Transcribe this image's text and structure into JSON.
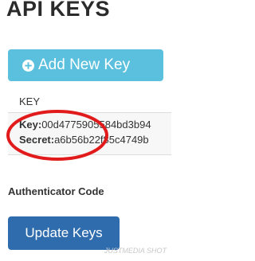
{
  "page": {
    "title": "API KEYS"
  },
  "actions": {
    "add_key_label": "Add New Key",
    "update_keys_label": "Update Keys"
  },
  "table": {
    "header": "KEY",
    "row": {
      "key_label": "Key:",
      "key_value": "00d4775905584bd3b94",
      "secret_label": "Secret:",
      "secret_value": "a6b56b22f85c4749b"
    }
  },
  "form": {
    "authenticator_label": "Authenticator Code"
  },
  "watermark": {
    "text": "JUSTMEDIA SHOT"
  },
  "colors": {
    "add_button": "#5bc0de",
    "update_button": "#2f6cae",
    "highlight_ellipse": "#e11b1b"
  },
  "icons": {
    "add": "plus-circle-icon"
  }
}
